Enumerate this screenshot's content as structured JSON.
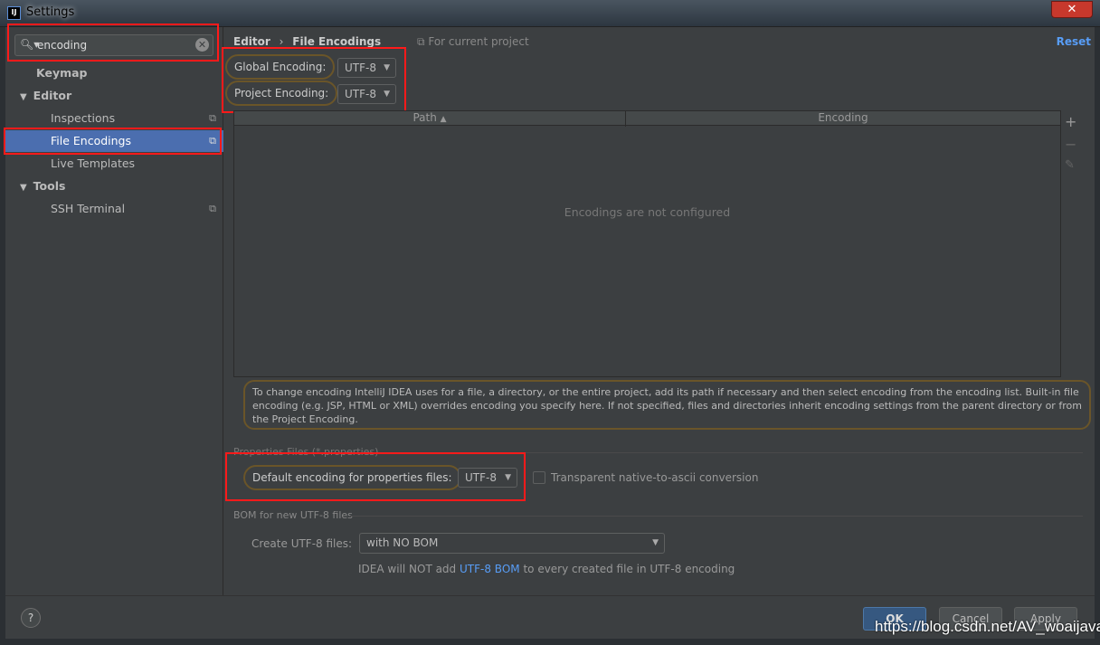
{
  "window": {
    "title": "Settings",
    "app_icon": "IJ",
    "close": "✕"
  },
  "search": {
    "value": "encoding",
    "icon": "search-icon",
    "clear": "✕"
  },
  "sidebar": {
    "items": [
      {
        "label": "Keymap"
      },
      {
        "label": "Editor"
      },
      {
        "label": "Inspections"
      },
      {
        "label": "File Encodings"
      },
      {
        "label": "Live Templates"
      },
      {
        "label": "Tools"
      },
      {
        "label": "SSH Terminal"
      }
    ]
  },
  "header": {
    "crumb1": "Editor",
    "sep": "›",
    "crumb2": "File Encodings",
    "scope": "For current project",
    "reset": "Reset"
  },
  "encodings": {
    "global_label": "Global Encoding:",
    "global_value": "UTF-8",
    "project_label": "Project Encoding:",
    "project_value": "UTF-8"
  },
  "table": {
    "col_path": "Path",
    "col_encoding": "Encoding",
    "empty": "Encodings are not configured",
    "add": "+",
    "remove": "−",
    "edit": "✎"
  },
  "info": "To change encoding IntelliJ IDEA uses for a file, a directory, or the entire project, add its path if necessary and then select encoding from the encoding list. Built-in file encoding (e.g. JSP, HTML or XML) overrides encoding you specify here. If not specified, files and directories inherit encoding settings from the parent directory or from the Project Encoding.",
  "properties": {
    "section": "Properties Files (*.properties)",
    "label": "Default encoding for properties files:",
    "value": "UTF-8",
    "checkbox": "Transparent native-to-ascii conversion",
    "checked": false
  },
  "bom": {
    "section": "BOM for new UTF-8 files",
    "label": "Create UTF-8 files:",
    "value": "with NO BOM",
    "note_pre": "IDEA will NOT add",
    "note_link": "UTF-8 BOM",
    "note_post": "to every created file in UTF-8 encoding"
  },
  "buttons": {
    "help": "?",
    "ok": "OK",
    "cancel": "Cancel",
    "apply": "Apply"
  },
  "watermark": "https://blog.csdn.net/AV_woaijava",
  "colors": {
    "accent": "#4b6eaf",
    "highlight_box": "#ff1a1a",
    "link": "#589df6"
  }
}
